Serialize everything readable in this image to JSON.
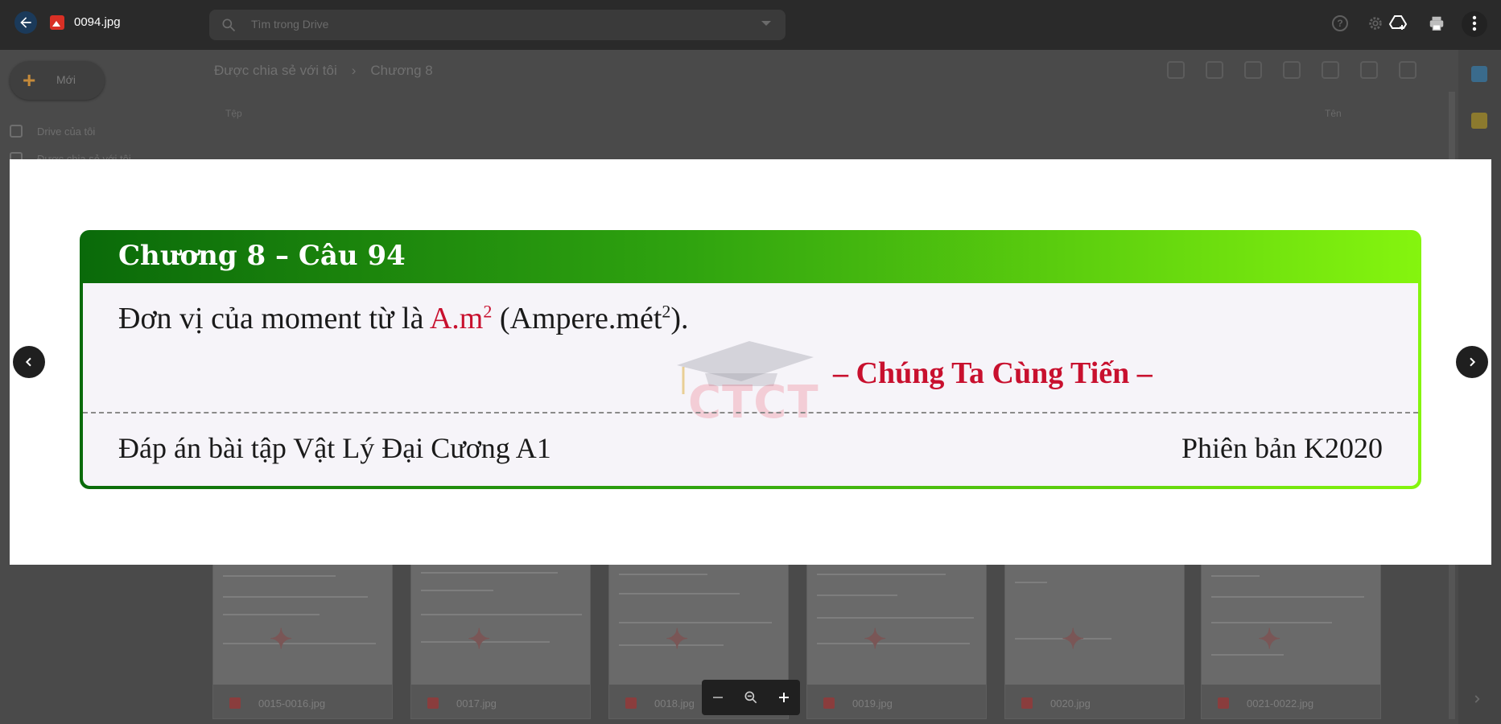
{
  "viewer": {
    "file_name": "0094.jpg",
    "back_icon": "arrow-left-icon",
    "prev_icon": "chevron-left-icon",
    "next_icon": "chevron-right-icon"
  },
  "drive": {
    "search_placeholder": "Tìm trong Drive",
    "new_button": "Mới",
    "nav": [
      "Drive của tôi",
      "Được chia sẻ với tôi"
    ],
    "breadcrumb": [
      "Được chia sẻ với tôi",
      "Chương 8"
    ],
    "col_file": "Tệp",
    "col_name": "Tên",
    "files": [
      "0015-0016.jpg",
      "0017.jpg",
      "0018.jpg",
      "0019.jpg",
      "0020.jpg",
      "0021-0022.jpg"
    ]
  },
  "slide": {
    "title": "Chương 8 – Câu 94",
    "line_prefix": "Đơn vị của moment từ là ",
    "unit_red": "A.m",
    "unit_exp": "2",
    "line_mid": " (Ampere.mét",
    "line_exp": "2",
    "line_end": ").",
    "slogan": "– Chúng Ta Cùng Tiến –",
    "watermark": "CTCT",
    "footer_left": "Đáp án bài tập Vật Lý Đại Cương A1",
    "footer_right": "Phiên bản K2020"
  },
  "colors": {
    "accent_red": "#c8102e",
    "banner_start": "#0a6a0a",
    "banner_end": "#85f50e"
  }
}
